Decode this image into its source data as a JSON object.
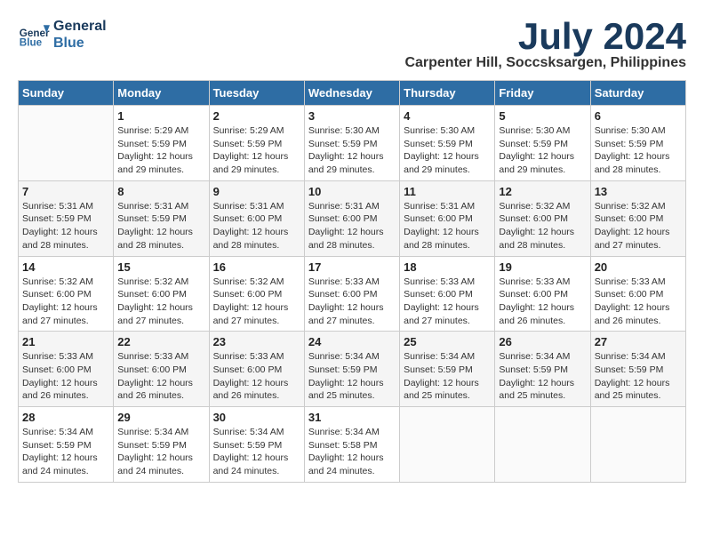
{
  "logo": {
    "line1": "General",
    "line2": "Blue"
  },
  "month": "July 2024",
  "location": "Carpenter Hill, Soccsksargen, Philippines",
  "days_of_week": [
    "Sunday",
    "Monday",
    "Tuesday",
    "Wednesday",
    "Thursday",
    "Friday",
    "Saturday"
  ],
  "weeks": [
    [
      {
        "num": "",
        "info": ""
      },
      {
        "num": "1",
        "info": "Sunrise: 5:29 AM\nSunset: 5:59 PM\nDaylight: 12 hours\nand 29 minutes."
      },
      {
        "num": "2",
        "info": "Sunrise: 5:29 AM\nSunset: 5:59 PM\nDaylight: 12 hours\nand 29 minutes."
      },
      {
        "num": "3",
        "info": "Sunrise: 5:30 AM\nSunset: 5:59 PM\nDaylight: 12 hours\nand 29 minutes."
      },
      {
        "num": "4",
        "info": "Sunrise: 5:30 AM\nSunset: 5:59 PM\nDaylight: 12 hours\nand 29 minutes."
      },
      {
        "num": "5",
        "info": "Sunrise: 5:30 AM\nSunset: 5:59 PM\nDaylight: 12 hours\nand 29 minutes."
      },
      {
        "num": "6",
        "info": "Sunrise: 5:30 AM\nSunset: 5:59 PM\nDaylight: 12 hours\nand 28 minutes."
      }
    ],
    [
      {
        "num": "7",
        "info": "Sunrise: 5:31 AM\nSunset: 5:59 PM\nDaylight: 12 hours\nand 28 minutes."
      },
      {
        "num": "8",
        "info": "Sunrise: 5:31 AM\nSunset: 5:59 PM\nDaylight: 12 hours\nand 28 minutes."
      },
      {
        "num": "9",
        "info": "Sunrise: 5:31 AM\nSunset: 6:00 PM\nDaylight: 12 hours\nand 28 minutes."
      },
      {
        "num": "10",
        "info": "Sunrise: 5:31 AM\nSunset: 6:00 PM\nDaylight: 12 hours\nand 28 minutes."
      },
      {
        "num": "11",
        "info": "Sunrise: 5:31 AM\nSunset: 6:00 PM\nDaylight: 12 hours\nand 28 minutes."
      },
      {
        "num": "12",
        "info": "Sunrise: 5:32 AM\nSunset: 6:00 PM\nDaylight: 12 hours\nand 28 minutes."
      },
      {
        "num": "13",
        "info": "Sunrise: 5:32 AM\nSunset: 6:00 PM\nDaylight: 12 hours\nand 27 minutes."
      }
    ],
    [
      {
        "num": "14",
        "info": "Sunrise: 5:32 AM\nSunset: 6:00 PM\nDaylight: 12 hours\nand 27 minutes."
      },
      {
        "num": "15",
        "info": "Sunrise: 5:32 AM\nSunset: 6:00 PM\nDaylight: 12 hours\nand 27 minutes."
      },
      {
        "num": "16",
        "info": "Sunrise: 5:32 AM\nSunset: 6:00 PM\nDaylight: 12 hours\nand 27 minutes."
      },
      {
        "num": "17",
        "info": "Sunrise: 5:33 AM\nSunset: 6:00 PM\nDaylight: 12 hours\nand 27 minutes."
      },
      {
        "num": "18",
        "info": "Sunrise: 5:33 AM\nSunset: 6:00 PM\nDaylight: 12 hours\nand 27 minutes."
      },
      {
        "num": "19",
        "info": "Sunrise: 5:33 AM\nSunset: 6:00 PM\nDaylight: 12 hours\nand 26 minutes."
      },
      {
        "num": "20",
        "info": "Sunrise: 5:33 AM\nSunset: 6:00 PM\nDaylight: 12 hours\nand 26 minutes."
      }
    ],
    [
      {
        "num": "21",
        "info": "Sunrise: 5:33 AM\nSunset: 6:00 PM\nDaylight: 12 hours\nand 26 minutes."
      },
      {
        "num": "22",
        "info": "Sunrise: 5:33 AM\nSunset: 6:00 PM\nDaylight: 12 hours\nand 26 minutes."
      },
      {
        "num": "23",
        "info": "Sunrise: 5:33 AM\nSunset: 6:00 PM\nDaylight: 12 hours\nand 26 minutes."
      },
      {
        "num": "24",
        "info": "Sunrise: 5:34 AM\nSunset: 5:59 PM\nDaylight: 12 hours\nand 25 minutes."
      },
      {
        "num": "25",
        "info": "Sunrise: 5:34 AM\nSunset: 5:59 PM\nDaylight: 12 hours\nand 25 minutes."
      },
      {
        "num": "26",
        "info": "Sunrise: 5:34 AM\nSunset: 5:59 PM\nDaylight: 12 hours\nand 25 minutes."
      },
      {
        "num": "27",
        "info": "Sunrise: 5:34 AM\nSunset: 5:59 PM\nDaylight: 12 hours\nand 25 minutes."
      }
    ],
    [
      {
        "num": "28",
        "info": "Sunrise: 5:34 AM\nSunset: 5:59 PM\nDaylight: 12 hours\nand 24 minutes."
      },
      {
        "num": "29",
        "info": "Sunrise: 5:34 AM\nSunset: 5:59 PM\nDaylight: 12 hours\nand 24 minutes."
      },
      {
        "num": "30",
        "info": "Sunrise: 5:34 AM\nSunset: 5:59 PM\nDaylight: 12 hours\nand 24 minutes."
      },
      {
        "num": "31",
        "info": "Sunrise: 5:34 AM\nSunset: 5:58 PM\nDaylight: 12 hours\nand 24 minutes."
      },
      {
        "num": "",
        "info": ""
      },
      {
        "num": "",
        "info": ""
      },
      {
        "num": "",
        "info": ""
      }
    ]
  ]
}
